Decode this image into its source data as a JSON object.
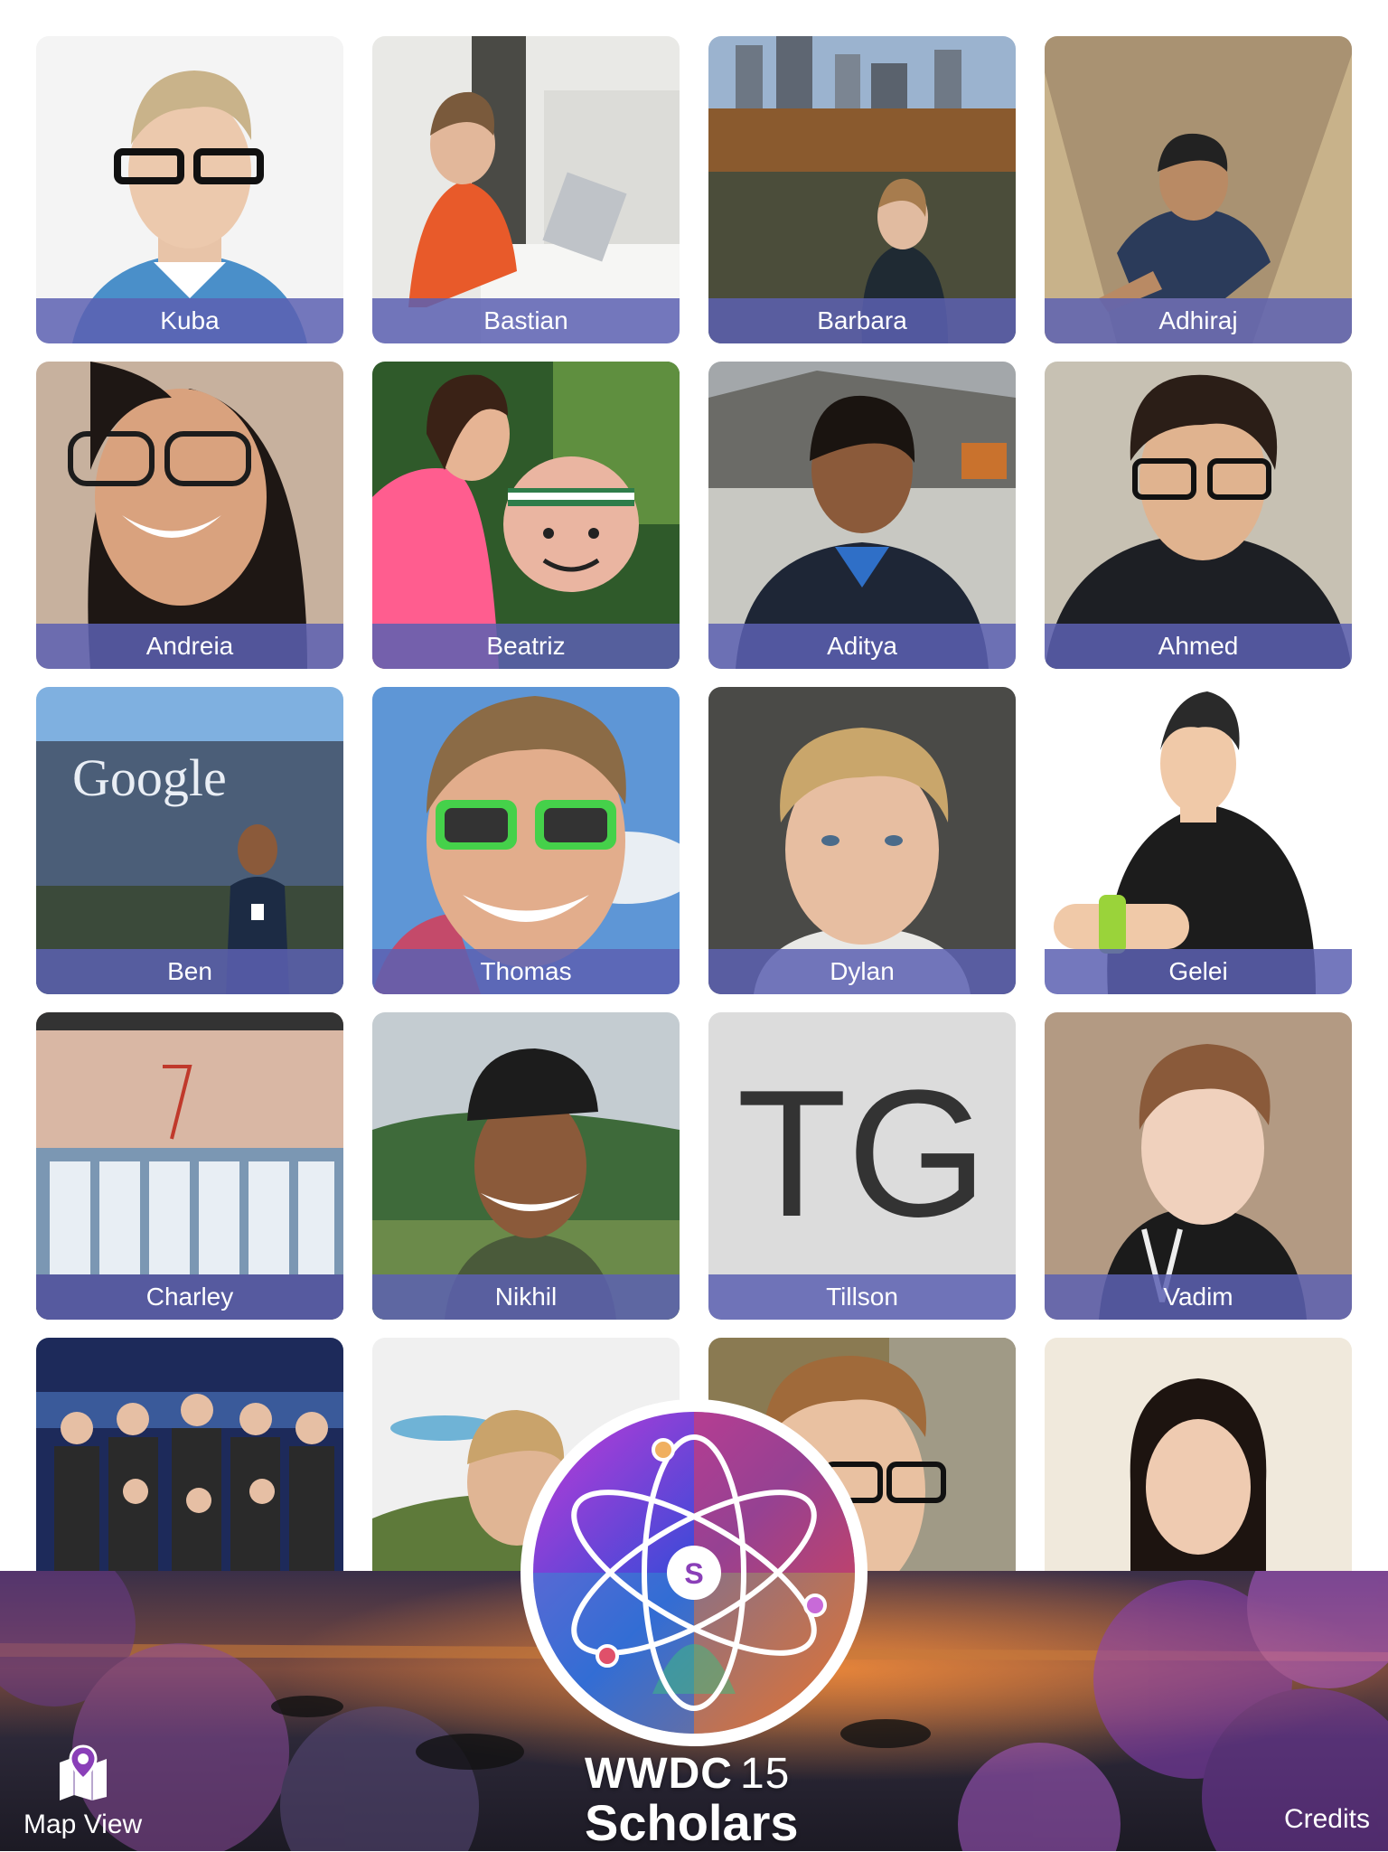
{
  "scholars": [
    {
      "name": "Kuba"
    },
    {
      "name": "Bastian"
    },
    {
      "name": "Barbara"
    },
    {
      "name": "Adhiraj"
    },
    {
      "name": "Andreia"
    },
    {
      "name": "Beatriz"
    },
    {
      "name": "Aditya"
    },
    {
      "name": "Ahmed"
    },
    {
      "name": "Ben"
    },
    {
      "name": "Thomas"
    },
    {
      "name": "Dylan"
    },
    {
      "name": "Gelei"
    },
    {
      "name": "Charley"
    },
    {
      "name": "Nikhil"
    },
    {
      "name": "Tillson"
    },
    {
      "name": "Vadim"
    },
    {
      "name": ""
    },
    {
      "name": ""
    },
    {
      "name": ""
    },
    {
      "name": ""
    }
  ],
  "tile_texts": {
    "google_sign": "Google",
    "tillson_initials": "TG",
    "logo_letter": "S"
  },
  "footer": {
    "map_view_label": "Map View",
    "credits_label": "Credits",
    "brand_wwdc": "WWDC",
    "brand_year": "15",
    "brand_scholars": "Scholars"
  },
  "colors": {
    "name_bar": "#5c60b2",
    "accent_purple": "#8a3fb8"
  }
}
